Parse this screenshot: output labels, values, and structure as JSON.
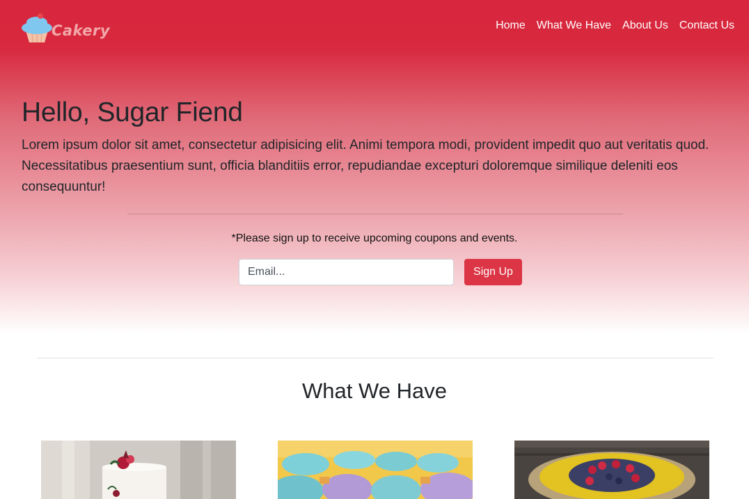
{
  "brand": {
    "name": "Cakery",
    "logo_icon": "cupcake-icon"
  },
  "nav": {
    "items": [
      {
        "label": "Home"
      },
      {
        "label": "What We Have"
      },
      {
        "label": "About Us"
      },
      {
        "label": "Contact Us"
      }
    ]
  },
  "hero": {
    "title": "Hello, Sugar Fiend",
    "lead": "Lorem ipsum dolor sit amet, consectetur adipisicing elit. Animi tempora modi, provident impedit quo aut veritatis quod. Necessitatibus praesentium sunt, officia blanditiis error, repudiandae excepturi doloremque similique deleniti eos consequuntur!",
    "signup_note": "*Please sign up to receive upcoming coupons and events.",
    "email_placeholder": "Email...",
    "email_value": "",
    "signup_label": "Sign Up"
  },
  "section": {
    "title": "What We Have",
    "cards": [
      {
        "image": "white-cake-with-flowers"
      },
      {
        "image": "blue-and-purple-cupcakes"
      },
      {
        "image": "berry-cheesecake"
      }
    ]
  },
  "colors": {
    "brand_red": "#d7263d",
    "button_red": "#dc3545",
    "logo_text": "#f2a7a9",
    "nav_text": "#ffffff"
  }
}
